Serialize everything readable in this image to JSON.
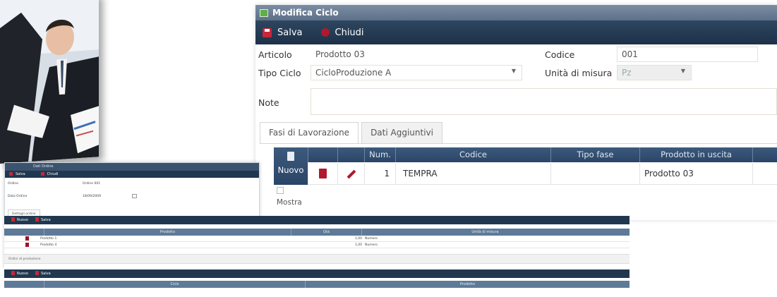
{
  "main_window": {
    "title": "Modifica Ciclo",
    "toolbar": {
      "save_label": "Salva",
      "close_label": "Chiudi"
    },
    "form": {
      "articolo_label": "Articolo",
      "articolo_value": "Prodotto 03",
      "codice_label": "Codice",
      "codice_value": "001",
      "tipo_ciclo_label": "Tipo Ciclo",
      "tipo_ciclo_value": "CicloProduzione A",
      "unita_label": "Unità di misura",
      "unita_value": "Pz",
      "note_label": "Note",
      "note_value": ""
    },
    "tabs": [
      {
        "label": "Fasi di Lavorazione"
      },
      {
        "label": "Dati Aggiuntivi"
      }
    ],
    "grid": {
      "nuovo_label": "Nuovo",
      "columns": [
        "Num.",
        "Codice",
        "Tipo fase",
        "Prodotto in uscita"
      ],
      "rows": [
        {
          "num": "1",
          "codice": "TEMPRA",
          "tipo_fase": "",
          "prodotto": "Prodotto 03"
        }
      ],
      "mostra_label": "Mostra"
    }
  },
  "back_window": {
    "title": "Dati Ordine",
    "toolbar": {
      "save_label": "Salva",
      "close_label": "Chiudi"
    },
    "form": {
      "ordine_label": "Ordine",
      "ordine_value": "Ordine 001",
      "data_label": "Data Ordine",
      "data_value": "18/09/2009"
    },
    "tab_label": "Dettagli ordine",
    "grid1": {
      "toolbar": {
        "new_label": "Nuovo",
        "save_label": "Salva"
      },
      "columns": [
        "Prodotto",
        "Qtà",
        "Unità di misura"
      ],
      "rows": [
        {
          "prodotto": "Prodotto 1",
          "qta": "1,00",
          "unita": "Numero"
        },
        {
          "prodotto": "Prodotto 4",
          "qta": "1,00",
          "unita": "Numero"
        }
      ]
    },
    "section_label": "Ordini di produzione",
    "grid2": {
      "toolbar": {
        "new_label": "Nuovo",
        "save_label": "Salva"
      },
      "columns": [
        "Ciclo",
        "Prodotto"
      ]
    }
  },
  "colors": {
    "toolbar_dark": "#1d3149",
    "title_bar": "#5d7088",
    "accent_red": "#b0182d",
    "grid_header": "#2a4566"
  }
}
